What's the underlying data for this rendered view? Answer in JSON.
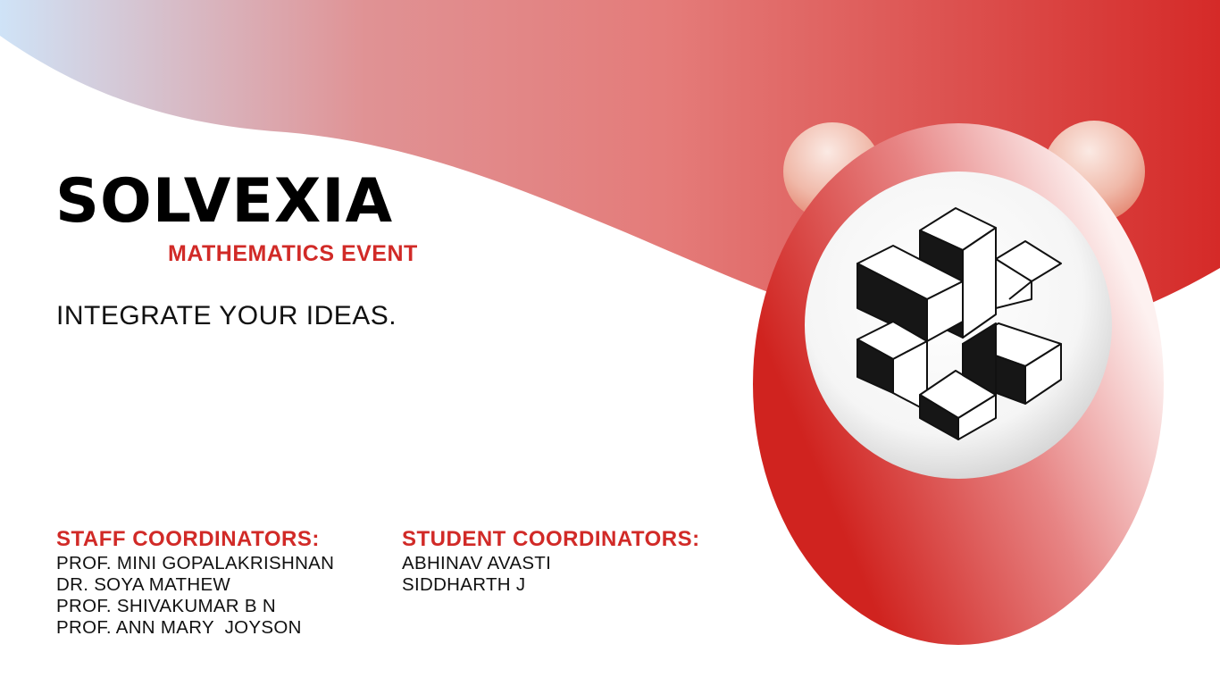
{
  "event": {
    "title": "SOLVEXIA",
    "subtitle": "MATHEMATICS EVENT",
    "tagline": "INTEGRATE YOUR IDEAS."
  },
  "staff": {
    "heading": "STAFF COORDINATORS:",
    "names": [
      "PROF. MINI GOPALAKRISHNAN",
      "DR. SOYA MATHEW",
      "PROF. SHIVAKUMAR B N",
      "PROF. ANN MARY  JOYSON"
    ]
  },
  "students": {
    "heading": "STUDENT COORDINATORS:",
    "names": [
      "ABHINAV AVASTI",
      "SIDDHARTH J"
    ]
  },
  "colors": {
    "accent_red": "#d12a27",
    "wave_start": "#cfe3f7",
    "wave_end": "#d52a28",
    "text": "#111111"
  }
}
